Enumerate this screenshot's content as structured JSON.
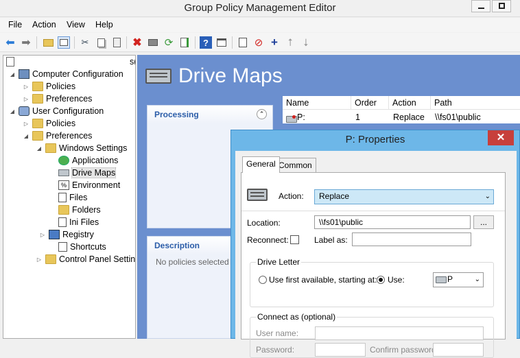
{
  "window": {
    "title": "Group Policy Management Editor"
  },
  "menu": [
    "File",
    "Action",
    "View",
    "Help"
  ],
  "tree": {
    "root_label": "s(",
    "computer_config": "Computer Configuration",
    "cc_policies": "Policies",
    "cc_preferences": "Preferences",
    "user_config": "User Configuration",
    "uc_policies": "Policies",
    "uc_preferences": "Preferences",
    "windows_settings": "Windows Settings",
    "applications": "Applications",
    "drive_maps": "Drive Maps",
    "environment": "Environment",
    "files": "Files",
    "folders": "Folders",
    "ini_files": "Ini Files",
    "registry": "Registry",
    "shortcuts": "Shortcuts",
    "control_panel": "Control Panel Setting"
  },
  "main": {
    "heading": "Drive Maps",
    "processing_label": "Processing",
    "description_label": "Description",
    "description_text": "No policies selected",
    "columns": [
      "Name",
      "Order",
      "Action",
      "Path"
    ],
    "rows": [
      {
        "name": "P:",
        "order": "1",
        "action": "Replace",
        "path": "\\\\fs01\\public"
      }
    ]
  },
  "dialog": {
    "title": "P: Properties",
    "close": "✕",
    "tabs": [
      "General",
      "Common"
    ],
    "action_label": "Action:",
    "action_value": "Replace",
    "location_label": "Location:",
    "location_value": "\\\\fs01\\public",
    "browse": "...",
    "reconnect_label": "Reconnect:",
    "label_as_label": "Label as:",
    "drive_letter_group": "Drive Letter",
    "use_first_label": "Use first available, starting at:",
    "use_label": "Use:",
    "use_value": "P",
    "connect_as_group": "Connect as (optional)",
    "username_label": "User name:",
    "password_label": "Password:",
    "confirm_password_label": "Confirm password:"
  }
}
